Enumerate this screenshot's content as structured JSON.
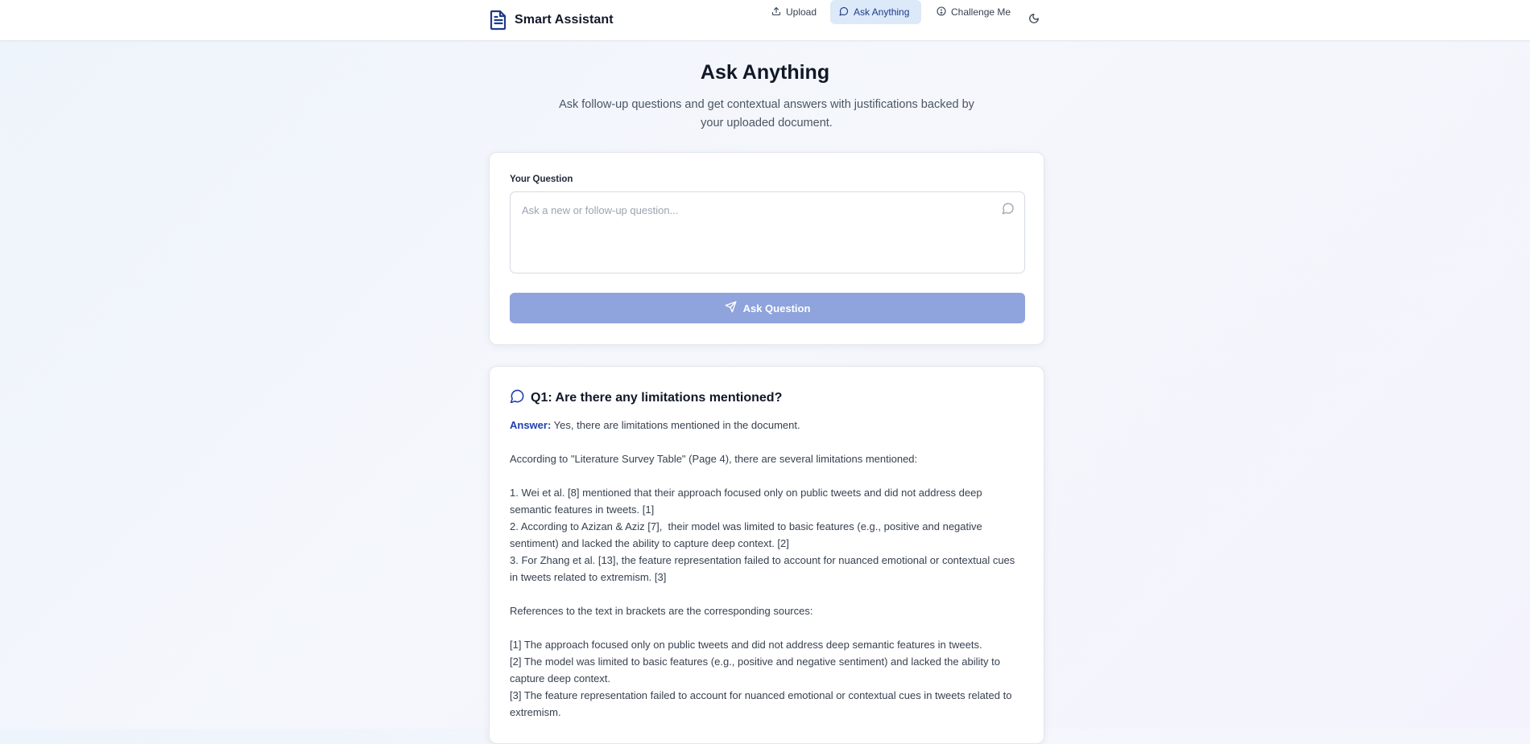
{
  "app": {
    "title": "Smart Assistant"
  },
  "nav": {
    "items": [
      {
        "label": "Upload",
        "icon": "upload-icon"
      },
      {
        "label": "Ask Anything",
        "icon": "message-circle-icon",
        "active": true
      },
      {
        "label": "Challenge Me",
        "icon": "lightbulb-icon"
      }
    ],
    "theme_icon": "moon-icon"
  },
  "hero": {
    "title": "Ask Anything",
    "subtitle": "Ask follow-up questions and get contextual answers with justifications backed by your uploaded document."
  },
  "ask_card": {
    "field_label": "Your Question",
    "placeholder": "Ask a new or follow-up question...",
    "value": "",
    "button_label": "Ask Question"
  },
  "answers": [
    {
      "question": "Q1: Are there any limitations mentioned?",
      "answer_label": "Answer:",
      "answer_text": " Yes, there are limitations mentioned in the document.\n\nAccording to \"Literature Survey Table\" (Page 4), there are several limitations mentioned:\n\n1. Wei et al. [8] mentioned that their approach focused only on public tweets and did not address deep semantic features in tweets. [1]\n2. According to Azizan & Aziz [7],  their model was limited to basic features (e.g., positive and negative sentiment) and lacked the ability to capture deep context. [2]\n3. For Zhang et al. [13], the feature representation failed to account for nuanced emotional or contextual cues in tweets related to extremism. [3]\n\nReferences to the text in brackets are the corresponding sources:\n\n[1] The approach focused only on public tweets and did not address deep semantic features in tweets.\n[2] The model was limited to basic features (e.g., positive and negative sentiment) and lacked the ability to capture deep context.\n[3] The feature representation failed to account for nuanced emotional or contextual cues in tweets related to extremism."
    }
  ],
  "colors": {
    "accent": "#1e40af",
    "nav_active_bg": "#dce9f8",
    "button_bg": "#8fa3dc"
  }
}
